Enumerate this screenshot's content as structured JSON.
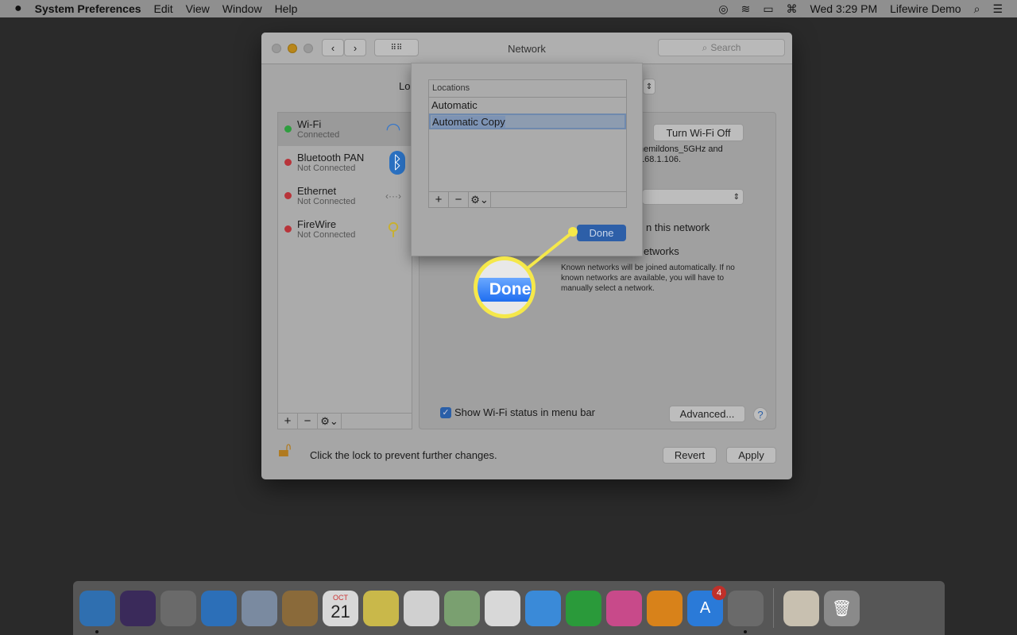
{
  "menubar": {
    "apple": "",
    "app": "System Preferences",
    "menus": [
      "Edit",
      "View",
      "Window",
      "Help"
    ],
    "clock": "Wed 3:29 PM",
    "user": "Lifewire Demo"
  },
  "window": {
    "title": "Network",
    "search_placeholder": "Search",
    "location_label": "Lo",
    "services": [
      {
        "name": "Wi-Fi",
        "status": "Connected",
        "color": "#2e9e3e",
        "icon": "wifi-icon",
        "glyph": "◠"
      },
      {
        "name": "Bluetooth PAN",
        "status": "Not Connected",
        "color": "#b8343a",
        "icon": "bluetooth-icon",
        "glyph": "ᛒ"
      },
      {
        "name": "Ethernet",
        "status": "Not Connected",
        "color": "#b8343a",
        "icon": "ethernet-icon",
        "glyph": "‹···›"
      },
      {
        "name": "FireWire",
        "status": "Not Connected",
        "color": "#b8343a",
        "icon": "firewire-icon",
        "glyph": "⚲"
      }
    ],
    "pane": {
      "turn_off": "Turn Wi-Fi Off",
      "status_line1": "hemildons_5GHz and",
      "status_line2": ".168.1.106.",
      "ask_partial": "n this network",
      "ask_networks_partial": "etworks",
      "known_text": "Known networks will be joined automatically. If no known networks are available, you will have to manually select a network.",
      "show_status": "Show Wi-Fi status in menu bar",
      "advanced": "Advanced...",
      "help": "?"
    },
    "lock_text": "Click the lock to prevent further changes.",
    "revert": "Revert",
    "apply": "Apply"
  },
  "sheet": {
    "header": "Locations",
    "locations": [
      "Automatic",
      "Automatic Copy"
    ],
    "selected": 1,
    "done": "Done"
  },
  "callout": {
    "label": "Done",
    "color": "#f5e84a"
  },
  "dock": {
    "calendar_month": "OCT",
    "calendar_day": "21",
    "appstore_badge": "4",
    "apps": [
      {
        "name": "finder",
        "bg": "#2f6fb0"
      },
      {
        "name": "siri",
        "bg": "#3a2a5a"
      },
      {
        "name": "launchpad",
        "bg": "#6a6a6a"
      },
      {
        "name": "safari",
        "bg": "#2c6fb8"
      },
      {
        "name": "mail",
        "bg": "#7a8aa0"
      },
      {
        "name": "contacts",
        "bg": "#8a6a3a"
      },
      {
        "name": "calendar",
        "bg": "#d8d8d8"
      },
      {
        "name": "notes",
        "bg": "#c9b84a"
      },
      {
        "name": "reminders",
        "bg": "#d0d0d0"
      },
      {
        "name": "maps",
        "bg": "#7aa070"
      },
      {
        "name": "photos",
        "bg": "#d8d8d8"
      },
      {
        "name": "messages",
        "bg": "#3a8ad8"
      },
      {
        "name": "facetime",
        "bg": "#2a9a3a"
      },
      {
        "name": "itunes",
        "bg": "#c84a8a"
      },
      {
        "name": "ibooks",
        "bg": "#d8821a"
      },
      {
        "name": "app-store",
        "bg": "#2a7ad8"
      },
      {
        "name": "system-preferences",
        "bg": "#6a6a6a"
      }
    ]
  }
}
